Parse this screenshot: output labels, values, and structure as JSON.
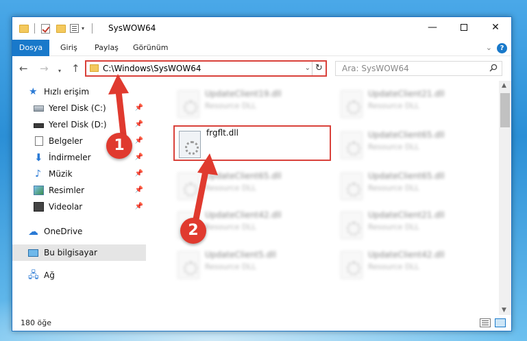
{
  "window": {
    "title": "SysWOW64",
    "controls": {
      "minimize": "—",
      "close": "✕"
    }
  },
  "ribbon": {
    "file_tab": "Dosya",
    "tabs": [
      "Giriş",
      "Paylaş",
      "Görünüm"
    ],
    "help": "?",
    "accent": "#1979ca"
  },
  "nav": {
    "address": "C:\\Windows\\SysWOW64",
    "search_placeholder": "Ara: SysWOW64"
  },
  "sidebar": {
    "items": [
      {
        "label": "Hızlı erişim",
        "icon": "star-icon",
        "pinned": false
      },
      {
        "label": "Yerel Disk (C:)",
        "icon": "local-disk-icon",
        "pinned": true
      },
      {
        "label": "Yerel Disk (D:)",
        "icon": "drive-icon",
        "pinned": true
      },
      {
        "label": "Belgeler",
        "icon": "documents-icon",
        "pinned": true
      },
      {
        "label": "İndirmeler",
        "icon": "downloads-icon",
        "pinned": true
      },
      {
        "label": "Müzik",
        "icon": "music-icon",
        "pinned": true
      },
      {
        "label": "Resimler",
        "icon": "pictures-icon",
        "pinned": true
      },
      {
        "label": "Videolar",
        "icon": "videos-icon",
        "pinned": true
      },
      {
        "label": "OneDrive",
        "icon": "onedrive-icon",
        "pinned": false
      },
      {
        "label": "Bu bilgisayar",
        "icon": "this-pc-icon",
        "pinned": false,
        "selected": true
      },
      {
        "label": "Ağ",
        "icon": "network-icon",
        "pinned": false
      }
    ]
  },
  "files": {
    "left": [
      {
        "name": "UpdateClient19.dll",
        "type": "Resource DLL"
      },
      {
        "name": "frgflt.dll",
        "type": "",
        "highlighted": true
      },
      {
        "name": "UpdateClient65.dll",
        "type": "Resource DLL"
      },
      {
        "name": "UpdateClient42.dll",
        "type": "Resource DLL"
      },
      {
        "name": "UpdateClient5.dll",
        "type": "Resource DLL"
      }
    ],
    "right": [
      {
        "name": "UpdateClient21.dll",
        "type": "Resource DLL"
      },
      {
        "name": "UpdateClient65.dll",
        "type": "Resource DLL"
      },
      {
        "name": "UpdateClient65.dll",
        "type": "Resource DLL"
      },
      {
        "name": "UpdateClient21.dll",
        "type": "Resource DLL"
      },
      {
        "name": "UpdateClient42.dll",
        "type": "Resource DLL"
      }
    ]
  },
  "status": {
    "count": "180 öğe"
  },
  "annotations": {
    "step1": "1",
    "step2": "2",
    "color": "#e03a2f"
  }
}
